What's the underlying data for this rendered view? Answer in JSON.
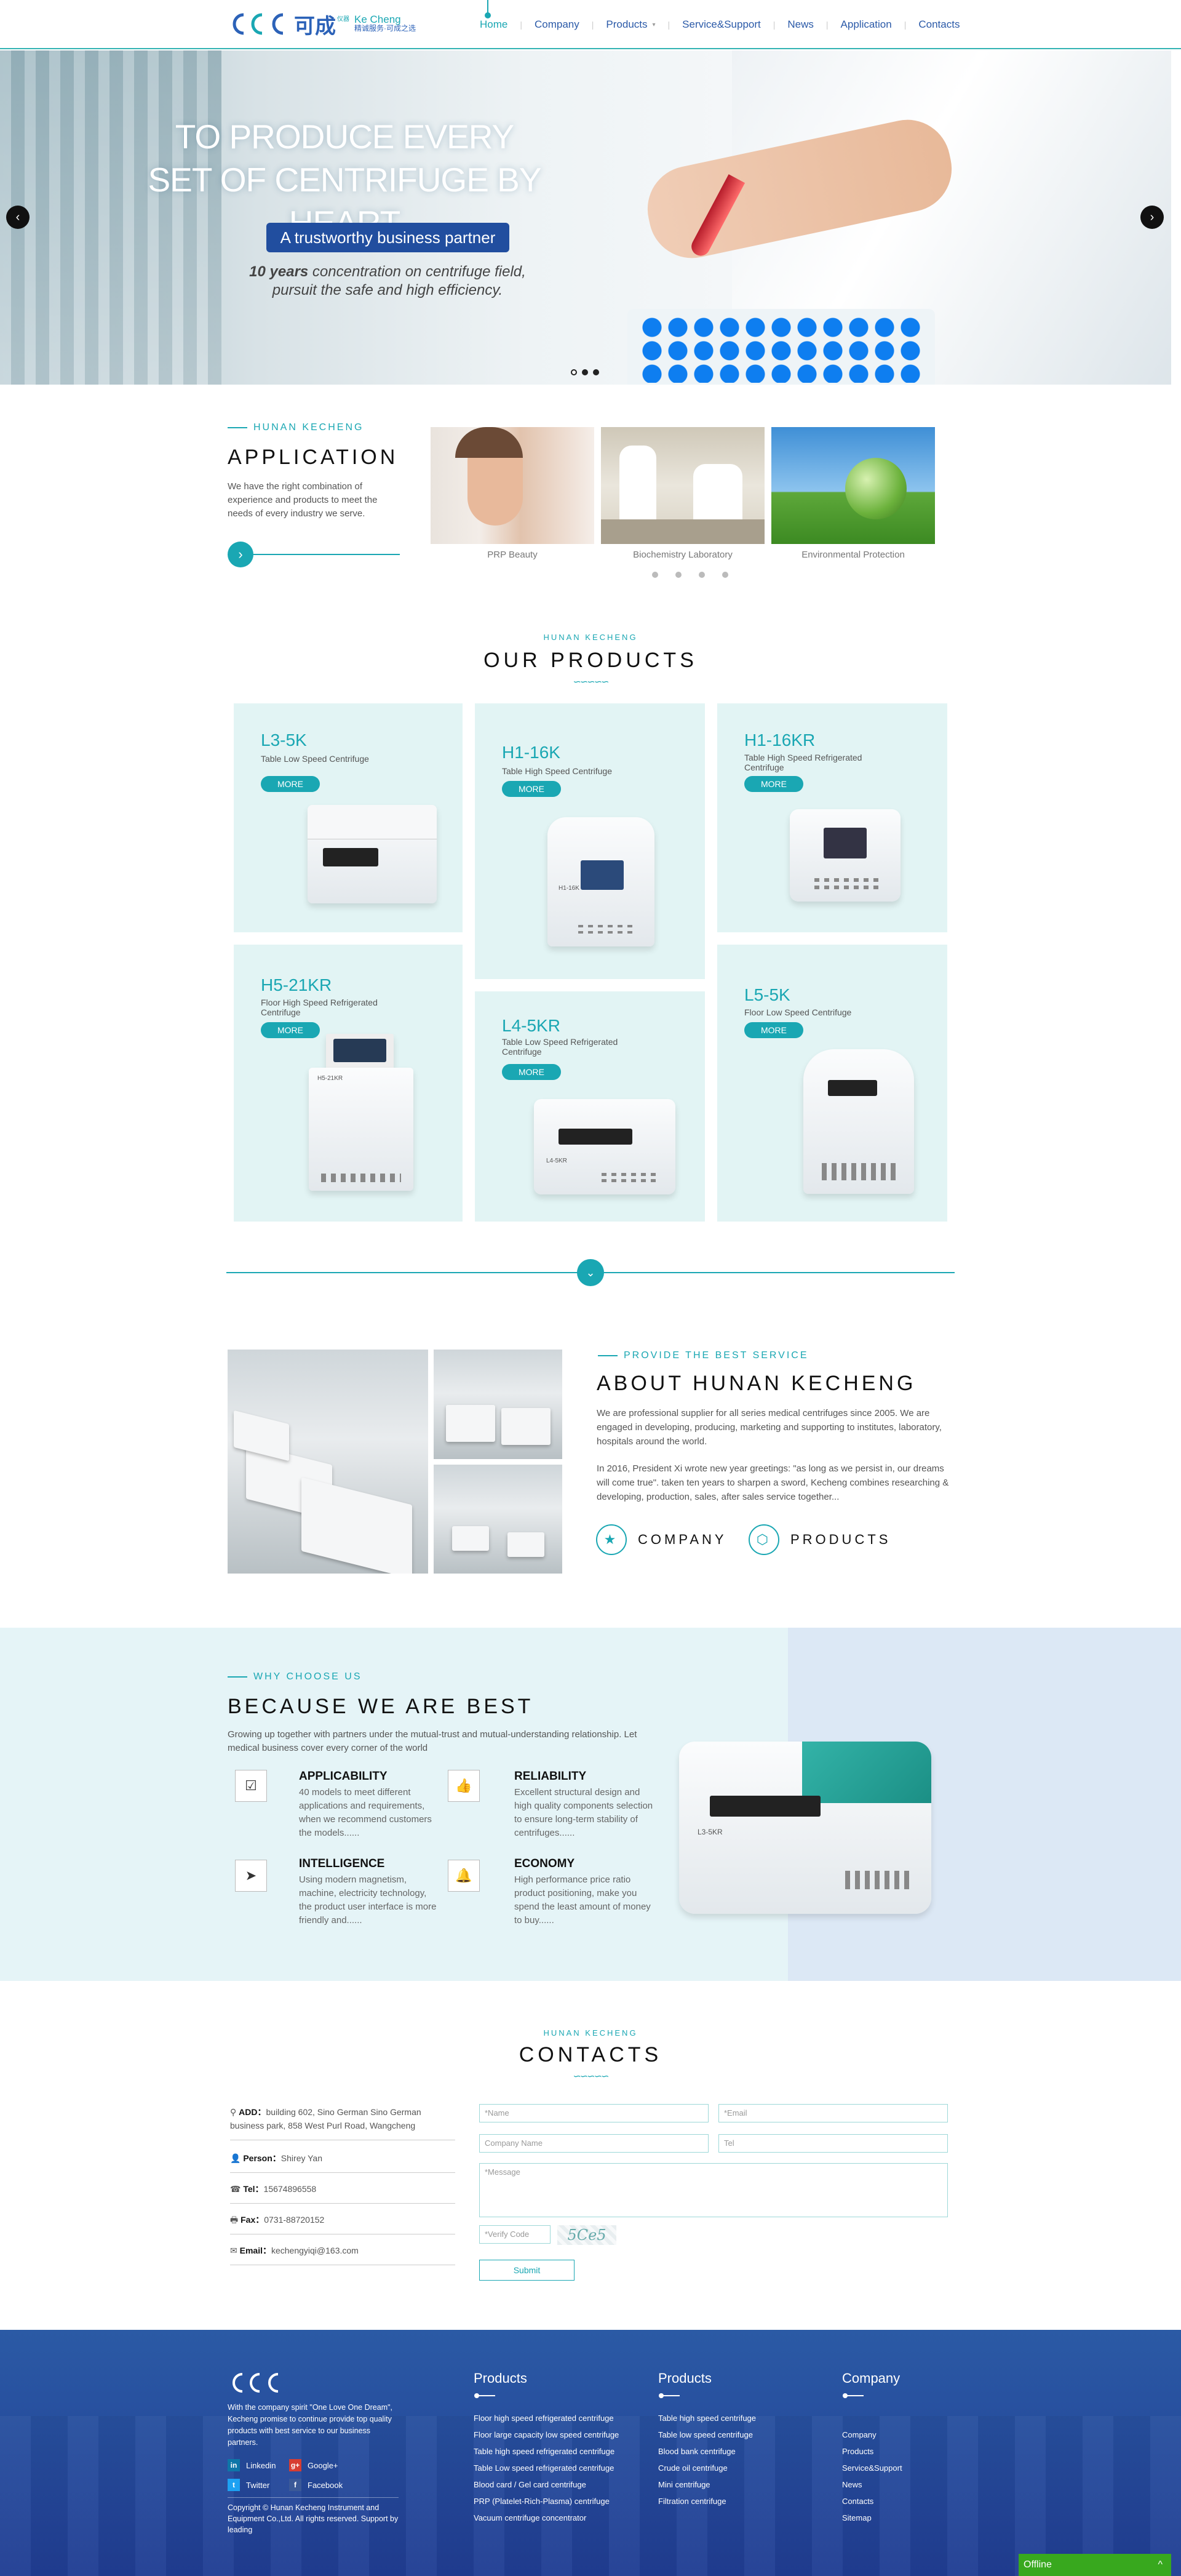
{
  "header": {
    "logo_cn": "可成",
    "logo_tag_cn": "精诚服务·可成之选",
    "logo_en": "Ke Cheng",
    "logo_sup": "仪器",
    "nav": [
      "Home",
      "Company",
      "Products",
      "Service&Support",
      "News",
      "Application",
      "Contacts"
    ]
  },
  "hero": {
    "title_line1": "TO PRODUCE EVERY",
    "title_line2": "SET OF CENTRIFUGE BY HEART",
    "tagline": "A trustworthy business partner",
    "desc_bold": "10 years",
    "desc_rest": " concentration on centrifuge field, pursuit the safe and high efficiency.",
    "prev": "‹",
    "next": "›"
  },
  "application": {
    "label": "HUNAN KECHENG",
    "title": "APPLICATION",
    "text": "We have the right combination of experience and products to meet the needs of every industry we serve.",
    "items": [
      "PRP Beauty",
      "Biochemistry Laboratory",
      "Environmental Protection"
    ]
  },
  "products": {
    "label": "HUNAN KECHENG",
    "title": "OUR PRODUCTS",
    "more": "MORE",
    "items": [
      {
        "name": "L3-5K",
        "desc": "Table Low Speed Centrifuge"
      },
      {
        "name": "H1-16K",
        "desc": "Table High Speed Centrifuge"
      },
      {
        "name": "H1-16KR",
        "desc": "Table High Speed Refrigerated Centrifuge"
      },
      {
        "name": "H5-21KR",
        "desc": "Floor High Speed Refrigerated Centrifuge"
      },
      {
        "name": "L4-5KR",
        "desc": "Table Low Speed Refrigerated Centrifuge"
      },
      {
        "name": "L5-5K",
        "desc": "Floor Low Speed Centrifuge"
      }
    ],
    "machine_labels": {
      "h1": "H1-16K",
      "l4": "L4-5KR",
      "h5": "H5-21KR"
    }
  },
  "about": {
    "label": "PROVIDE THE BEST SERVICE",
    "title": "ABOUT HUNAN KECHENG",
    "p1": "We are  professional supplier for all series medical centrifuges since 2005. We are engaged in developing, producing, marketing and supporting to institutes, laboratory, hospitals around the world.",
    "p2": "In 2016, President Xi wrote new year greetings: \"as long as we persist in, our dreams will come true\". taken ten years to sharpen a sword, Kecheng combines researching & developing, production, sales, after sales service together...",
    "btn_company": "COMPANY",
    "btn_products": "PRODUCTS"
  },
  "why": {
    "label": "WHY CHOOSE US",
    "title": "BECAUSE WE ARE BEST",
    "intro": "Growing up together with partners under the mutual-trust and mutual-understanding relationship. Let medical business cover every corner of the world",
    "features": [
      {
        "h": "APPLICABILITY",
        "t": "40 models to meet different applications and requirements, when we recommend customers the models......"
      },
      {
        "h": "RELIABILITY",
        "t": "Excellent structural design and high quality components selection to ensure long-term stability of centrifuges......"
      },
      {
        "h": "INTELLIGENCE",
        "t": "Using modern magnetism, machine, electricity technology, the product user interface is more friendly and......"
      },
      {
        "h": "ECONOMY",
        "t": "High performance price ratio product positioning, make you spend the least amount of money to buy......"
      }
    ],
    "machine_label": "L3-5KR"
  },
  "contacts": {
    "label": "HUNAN KECHENG",
    "title": "CONTACTS",
    "add_k": "ADD：",
    "add_v": "building 602, Sino German Sino German business park, 858 West Purl Road, Wangcheng",
    "person_k": "Person：",
    "person_v": "Shirey Yan",
    "tel_k": "Tel：",
    "tel_v": "15674896558",
    "fax_k": "Fax：",
    "fax_v": "0731-88720152",
    "email_k": "Email：",
    "email_v": "kechengyiqi@163.com",
    "ph_name": "*Name",
    "ph_email": "*Email",
    "ph_company": "Company Name",
    "ph_tel": "Tel",
    "ph_message": "*Message",
    "ph_code": "*Verify Code",
    "captcha": "5Ce5",
    "submit": "Submit"
  },
  "footer": {
    "about": "With the company spirit \"One Love One Dream\", Kecheng promise to continue provide top quality products with best service to our business partners.",
    "linkedin": "Linkedin",
    "google": "Google+",
    "twitter": "Twitter",
    "facebook": "Facebook",
    "copyright": "Copyright © Hunan Kecheng Instrument and Equipment Co.,Ltd. All rights reserved. Support by leading",
    "col1_title": "Products",
    "col1": [
      "Floor high speed refrigerated centrifuge",
      "Floor large capacity low speed centrifuge",
      "Table high speed refrigerated centrifuge",
      "Table Low speed refrigerated centrifuge",
      "Blood card / Gel card centrifuge",
      "PRP (Platelet-Rich-Plasma) centrifuge",
      "Vacuum centrifuge concentrator"
    ],
    "col2_title": "Products",
    "col2": [
      "Table high speed centrifuge",
      "Table low speed centrifuge",
      "Blood bank centrifuge",
      "Crude oil centrifuge",
      "Mini centrifuge",
      "Filtration centrifuge"
    ],
    "col3_title": "Company",
    "col3": [
      "Company",
      "Products",
      "Service&Support",
      "News",
      "Contacts",
      "Sitemap"
    ],
    "offline": "Offline",
    "offline_arrow": "^"
  }
}
